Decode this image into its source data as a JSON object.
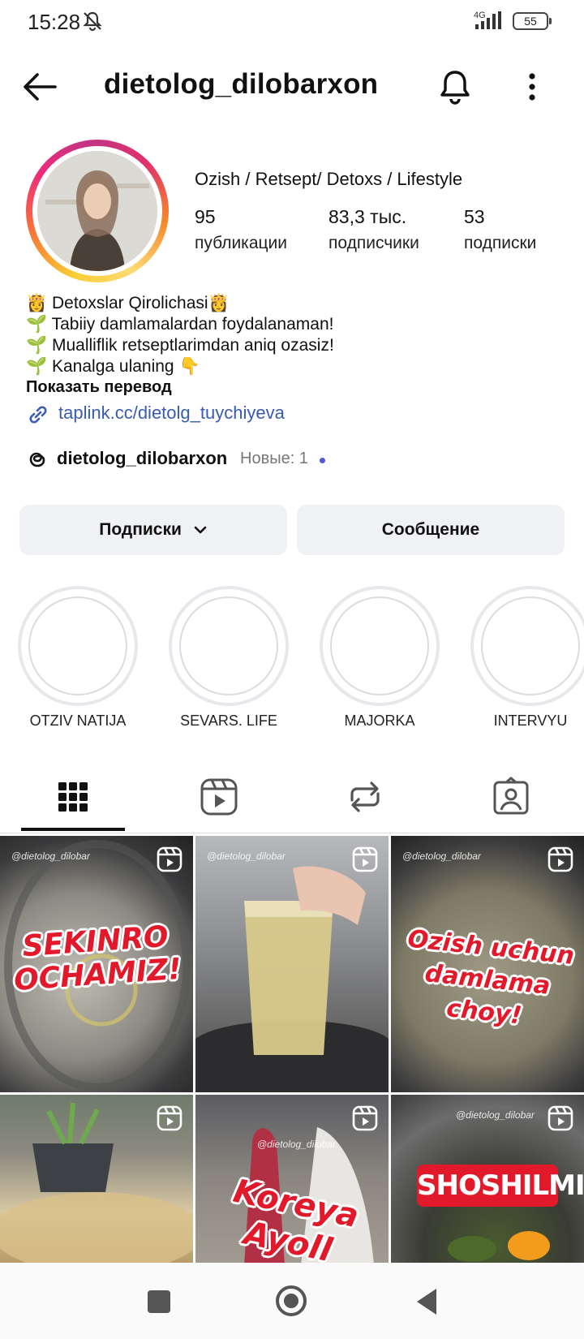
{
  "status_bar": {
    "time": "15:28",
    "network": "4G",
    "battery": "55"
  },
  "header": {
    "username": "dietolog_dilobarxon"
  },
  "profile": {
    "category": "Ozish / Retsept/  Detoxs / Lifestyle",
    "stats": [
      {
        "value": "95",
        "label": "публикации"
      },
      {
        "value": "83,3 тыс.",
        "label": "подписчики"
      },
      {
        "value": "53",
        "label": "подписки"
      }
    ],
    "bio": [
      "👸 Detoxslar  Qirolichasi👸",
      "🌱 Tabiiy damlamalardan foydalanaman!",
      "🌱 Mualliflik retseptlarimdan aniq ozasiz!",
      "🌱 Kanalga ulaning 👇"
    ],
    "show_translation": "Показать перевод",
    "link": "taplink.cc/dietolg_tuychiyeva",
    "threads_name": "dietolog_dilobarxon",
    "threads_new": "Новые: 1"
  },
  "actions": {
    "following": "Подписки",
    "message": "Сообщение"
  },
  "highlights": [
    "OTZIV NATIJA",
    "SEVARS. LIFE",
    "MAJORKA",
    "INTERVYU"
  ],
  "tabs": [
    "grid-icon",
    "reels-icon",
    "reposts-icon",
    "tagged-icon"
  ],
  "posts": [
    {
      "watermark": "@dietolog_dilobar",
      "caption_lines": [
        "SEKINRO",
        "OCHAMIZ!"
      ]
    },
    {
      "watermark": "@dietolog_dilobar",
      "caption_lines": []
    },
    {
      "watermark": "@dietolog_dilobar",
      "caption_lines": [
        "Ozish uchun",
        "damlama",
        "choy!"
      ]
    },
    {
      "watermark": "",
      "caption_lines": []
    },
    {
      "watermark": "@dietolog_dilobar",
      "caption_lines": [
        "Koreya",
        "Ayoll"
      ]
    },
    {
      "watermark": "@dietolog_dilobar",
      "caption_lines": [
        "SHOSHILMI"
      ]
    }
  ]
}
